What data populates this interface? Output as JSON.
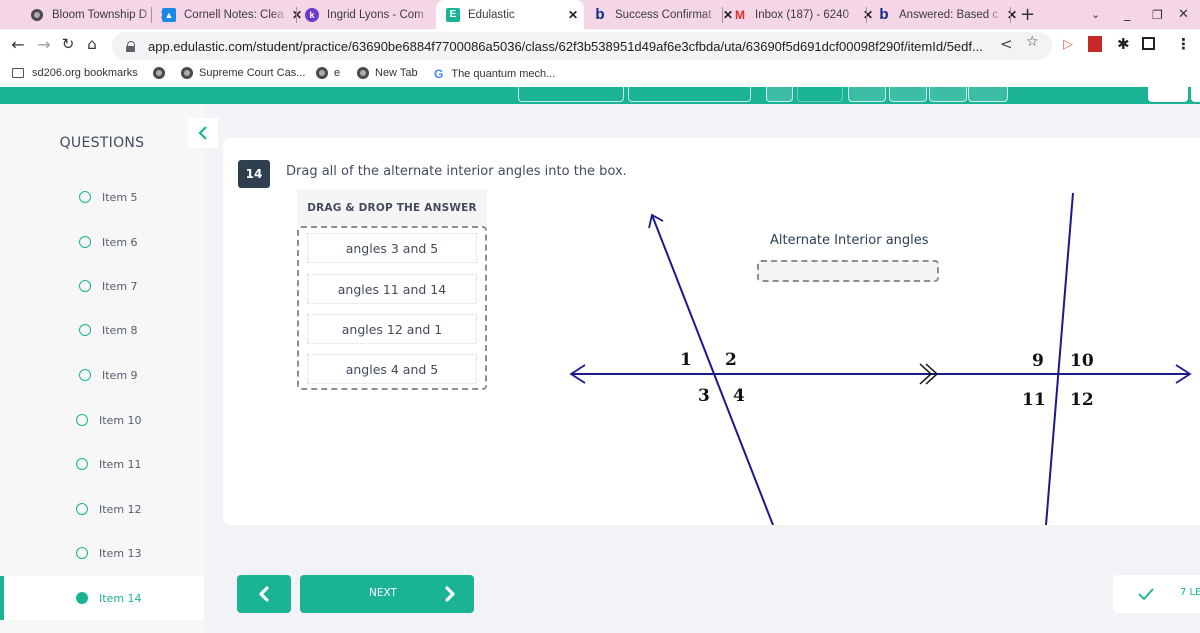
{
  "browser": {
    "tabs": [
      {
        "title": "Bloom Township D",
        "icon": "globe-icon",
        "active": false
      },
      {
        "title": "Cornell Notes: Clea",
        "icon": "google-classroom-icon",
        "active": false
      },
      {
        "title": "Ingrid Lyons - Com",
        "icon": "kami-icon",
        "active": false
      },
      {
        "title": "Edulastic",
        "icon": "edulastic-icon",
        "active": true
      },
      {
        "title": "Success Confirmat",
        "icon": "bartleby-icon",
        "active": false
      },
      {
        "title": "Inbox (187) - 6240",
        "icon": "gmail-icon",
        "active": false
      },
      {
        "title": "Answered: Based c",
        "icon": "bartleby-icon",
        "active": false
      }
    ],
    "close_glyph": "✕",
    "new_tab_glyph": "+",
    "url": "app.edulastic.com/student/practice/63690be6884f7700086a5036/class/62f3b538951d49af6e3cfbda/uta/63690f5d691dcf00098f290f/itemId/5edf...",
    "bookmarks": [
      {
        "label": "sd206.org bookmarks",
        "icon": "folder-icon"
      },
      {
        "label": "",
        "icon": "globe-icon"
      },
      {
        "label": "Supreme Court Cas...",
        "icon": "globe-icon"
      },
      {
        "label": "e",
        "icon": "globe-icon"
      },
      {
        "label": "New Tab",
        "icon": "globe-icon"
      },
      {
        "label": "The quantum mech...",
        "icon": "google-icon"
      }
    ]
  },
  "sidebar": {
    "title": "QUESTIONS",
    "items": [
      {
        "label": "Item 5",
        "active": false
      },
      {
        "label": "Item 6",
        "active": false
      },
      {
        "label": "Item 7",
        "active": false
      },
      {
        "label": "Item 8",
        "active": false
      },
      {
        "label": "Item 9",
        "active": false
      },
      {
        "label": "Item 10",
        "active": false
      },
      {
        "label": "Item 11",
        "active": false
      },
      {
        "label": "Item 12",
        "active": false
      },
      {
        "label": "Item 13",
        "active": false
      },
      {
        "label": "Item 14",
        "active": true
      }
    ]
  },
  "question": {
    "number": "14",
    "prompt": "Drag all of the alternate interior angles into the box.",
    "drag_header": "DRAG & DROP THE ANSWER",
    "choices": [
      "angles 3 and 5",
      "angles 11 and 14",
      "angles 12 and 1",
      "angles 4 and 5"
    ],
    "drop_label": "Alternate Interior angles",
    "drop_items": [],
    "diagram_labels": {
      "left_intersection": [
        "1",
        "2",
        "3",
        "4"
      ],
      "right_intersection": [
        "9",
        "10",
        "11",
        "12"
      ]
    }
  },
  "footer": {
    "next_label": "NEXT",
    "status_text": "7 LE"
  },
  "colors": {
    "accent": "#1ab394",
    "tabstrip": "#f5d6e6",
    "question_badge": "#2e3f50",
    "diagram_line": "#1a1a8c"
  }
}
